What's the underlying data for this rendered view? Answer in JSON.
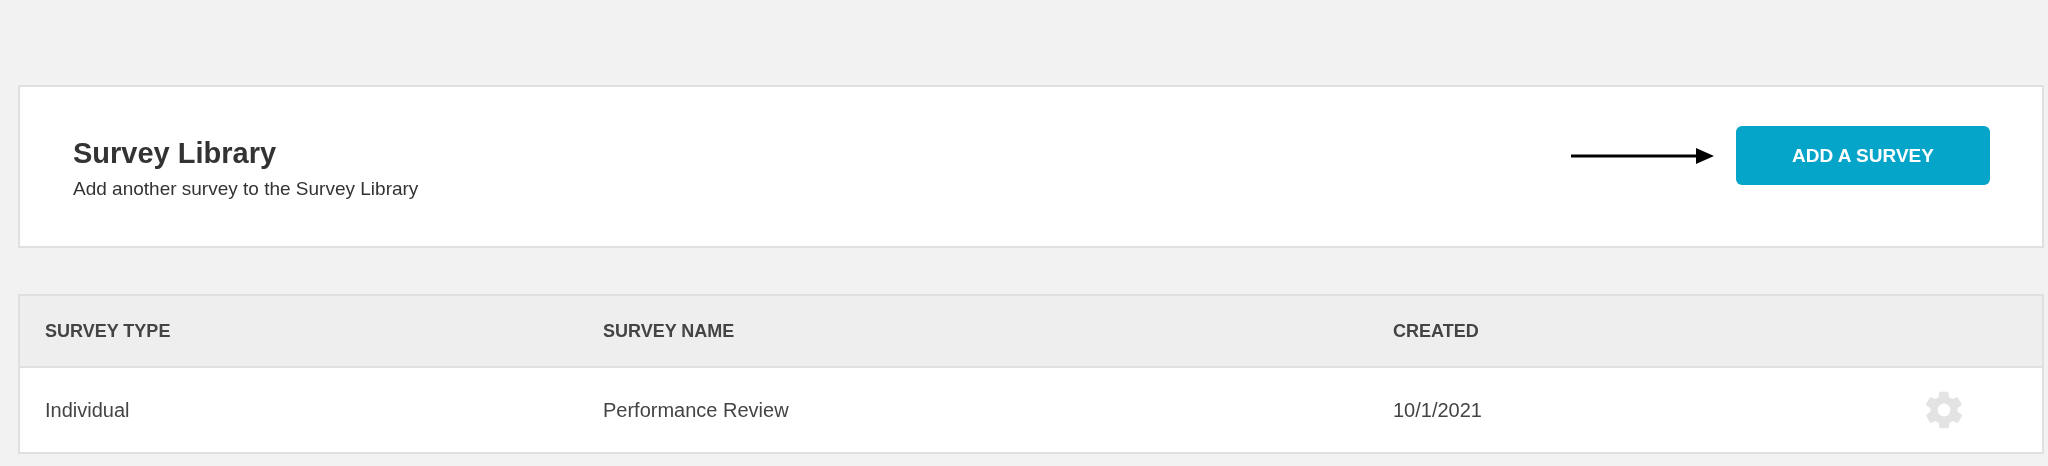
{
  "header": {
    "title": "Survey Library",
    "subtitle": "Add another survey to the Survey Library",
    "button": "ADD A SURVEY"
  },
  "table": {
    "columns": [
      "SURVEY TYPE",
      "SURVEY NAME",
      "CREATED"
    ],
    "rows": [
      {
        "cells": [
          "Individual",
          "Performance Review",
          "10/1/2021"
        ]
      }
    ]
  }
}
